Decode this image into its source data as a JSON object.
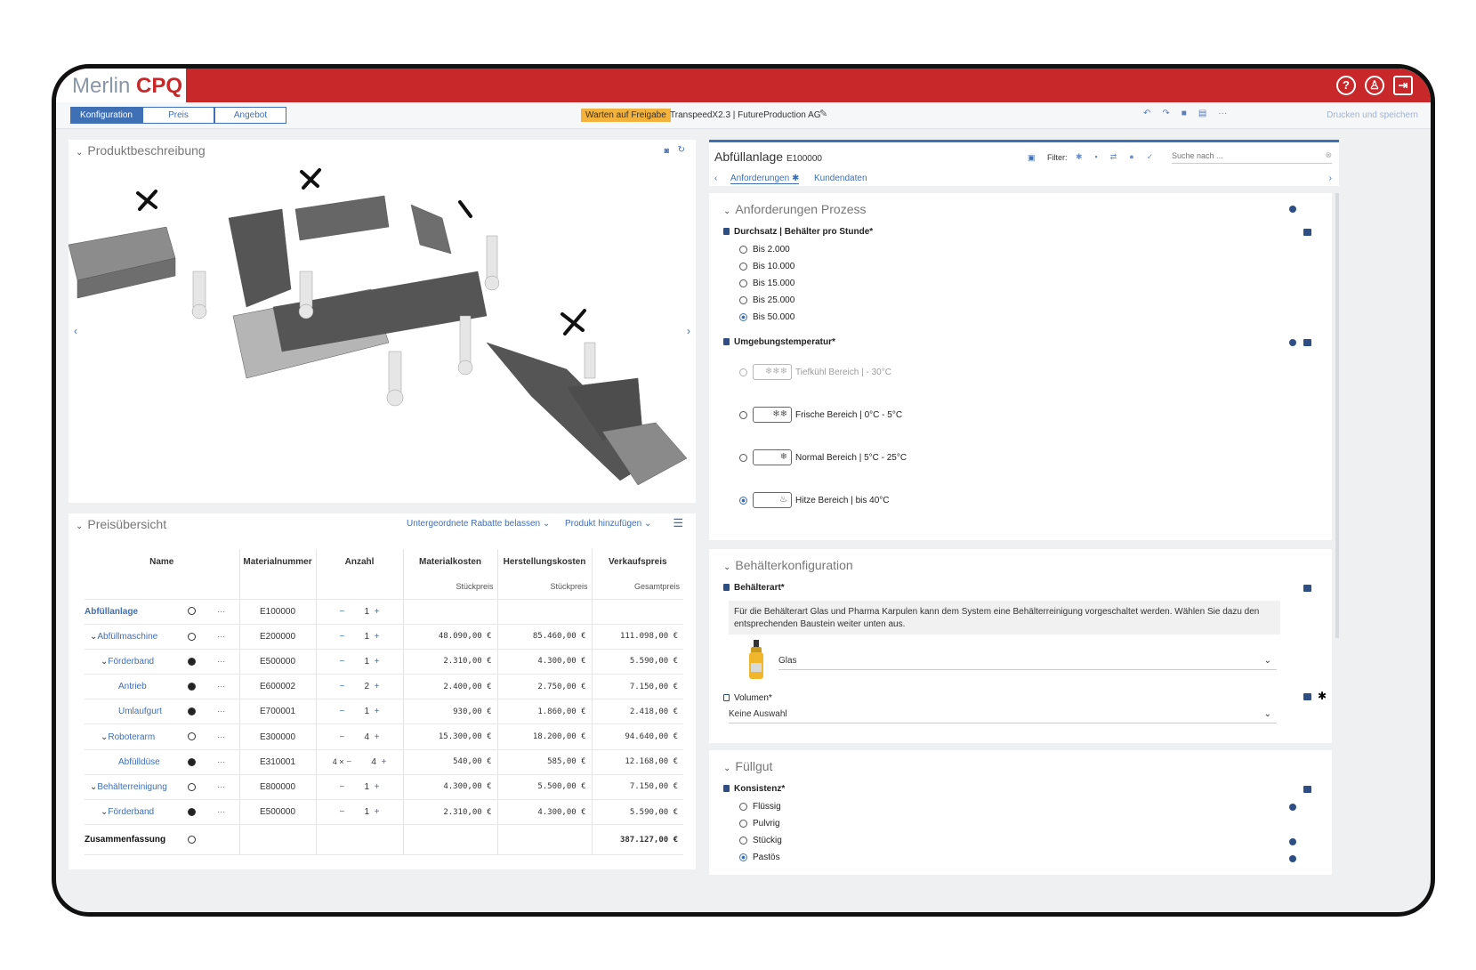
{
  "app": {
    "logo_a": "Merlin",
    "logo_b": "CPQ"
  },
  "topbar": {
    "help_icon": "?",
    "user_icon": "♙",
    "logout_icon": "⇥"
  },
  "tabs": [
    "Konfiguration",
    "Preis",
    "Angebot"
  ],
  "status_badge": "Warten auf Freigabe",
  "project": "TranspeedX2.3 | FutureProduction AG",
  "print_save": "Drucken und speichern",
  "product": {
    "title": "Produktbeschreibung"
  },
  "price": {
    "title": "Preisübersicht",
    "discount_action": "Untergeordnete Rabatte belassen",
    "add_product": "Produkt hinzufügen",
    "headers": [
      "Name",
      "Materialnummer",
      "Anzahl",
      "Materialkosten",
      "Herstellungskosten",
      "Verkaufspreis"
    ],
    "subheaders": [
      "Stückpreis",
      "Stückpreis",
      "Gesamtpreis"
    ],
    "rows": [
      {
        "name": "Abfüllanlage",
        "mat": "E100000",
        "qty": "1",
        "mk": "",
        "hk": "",
        "vp": ""
      },
      {
        "name": "Abfüllmaschine",
        "mat": "E200000",
        "qty": "1",
        "mk": "48.090,00 €",
        "hk": "85.460,00 €",
        "vp": "111.098,00 €"
      },
      {
        "name": "Förderband",
        "mat": "E500000",
        "qty": "1",
        "mk": "2.310,00 €",
        "hk": "4.300,00 €",
        "vp": "5.590,00 €"
      },
      {
        "name": "Antrieb",
        "mat": "E600002",
        "qty": "2",
        "mk": "2.400,00 €",
        "hk": "2.750,00 €",
        "vp": "7.150,00 €"
      },
      {
        "name": "Umlaufgurt",
        "mat": "E700001",
        "qty": "1",
        "mk": "930,00 €",
        "hk": "1.860,00 €",
        "vp": "2.418,00 €"
      },
      {
        "name": "Roboterarm",
        "mat": "E300000",
        "qty": "4",
        "mk": "15.300,00 €",
        "hk": "18.200,00 €",
        "vp": "94.640,00 €"
      },
      {
        "name": "Abfülldüse",
        "mat": "E310001",
        "qty": "4",
        "mult": "4 ×",
        "mk": "540,00 €",
        "hk": "585,00 €",
        "vp": "12.168,00 €"
      },
      {
        "name": "Behälterreinigung",
        "mat": "E800000",
        "qty": "1",
        "mk": "4.300,00 €",
        "hk": "5.500,00 €",
        "vp": "7.150,00 €"
      },
      {
        "name": "Förderband",
        "mat": "E500000",
        "qty": "1",
        "mk": "2.310,00 €",
        "hk": "4.300,00 €",
        "vp": "5.590,00 €"
      }
    ],
    "summary_label": "Zusammenfassung",
    "summary_total": "387.127,00 €"
  },
  "config": {
    "title": "Abfüllanlage",
    "code": "E100000",
    "filter_label": "Filter:",
    "search_placeholder": "Suche nach ...",
    "tab_anf": "Anforderungen",
    "tab_kd": "Kundendaten",
    "s1_title": "Anforderungen Prozess",
    "q1_label": "Durchsatz | Behälter pro Stunde*",
    "q1_options": [
      "Bis 2.000",
      "Bis 10.000",
      "Bis 15.000",
      "Bis 25.000",
      "Bis 50.000"
    ],
    "q2_label": "Umgebungstemperatur*",
    "q2_options": [
      "Tiefkühl Bereich | - 30°C",
      "Frische Bereich | 0°C - 5°C",
      "Normal Bereich | 5°C - 25°C",
      "Hitze Bereich | bis 40°C"
    ],
    "s2_title": "Behälterkonfiguration",
    "q3_label": "Behälterart*",
    "q3_note": "Für die Behälterart Glas und Pharma Karpulen kann dem System eine Behälterreinigung vorgeschaltet werden. Wählen Sie dazu den entsprechenden Baustein weiter unten aus.",
    "q3_value": "Glas",
    "q4_label": "Volumen*",
    "q4_value": "Keine Auswahl",
    "s3_title": "Füllgut",
    "q5_label": "Konsistenz*",
    "q5_options": [
      "Flüssig",
      "Pulvrig",
      "Stückig",
      "Pastös"
    ]
  }
}
